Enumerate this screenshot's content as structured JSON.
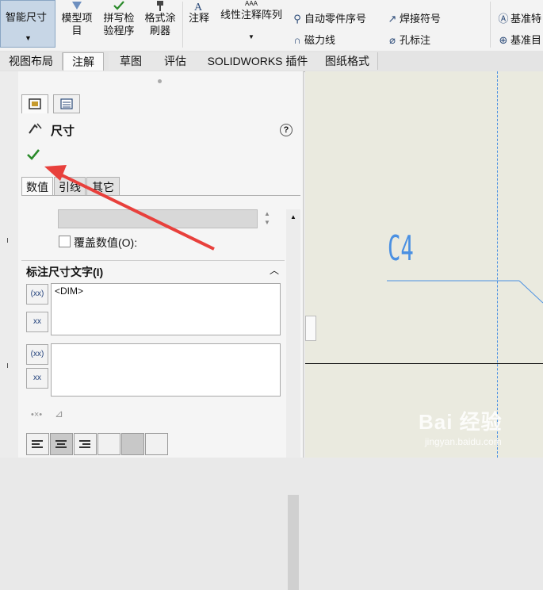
{
  "ribbon": {
    "smart_dimension": "智能尺寸",
    "model_items_l1": "模型项",
    "model_items_l2": "目",
    "spell_check_l1": "拼写检",
    "spell_check_l2": "验程序",
    "format_painter_l1": "格式涂",
    "format_painter_l2": "刷器",
    "note": "注释",
    "linear_note_pattern": "线性注释阵列",
    "auto_balloon": "自动零件序号",
    "magnetic_line": "磁力线",
    "weld_symbol": "焊接符号",
    "hole_callout": "孔标注",
    "datum_feature_1": "基准特",
    "datum_target_1": "基准目"
  },
  "tabs": [
    "视图布局",
    "注解",
    "草图",
    "评估",
    "SOLIDWORKS 插件",
    "图纸格式"
  ],
  "active_tab": "注解",
  "property_manager": {
    "title": "尺寸",
    "help": "?",
    "inner_tabs": [
      "数值",
      "引线",
      "其它"
    ],
    "override_value": "覆盖数值(O):",
    "dimension_text_header": "标注尺寸文字(I)",
    "dim_text": "<DIM>",
    "icon_paren": "(xx)",
    "icon_box": "xx"
  },
  "canvas": {
    "chamfer_label": "C4"
  },
  "watermark": {
    "brand": "Bai 经验",
    "url": "jingyan.baidu.com"
  },
  "colors": {
    "accent_blue": "#4a90e2",
    "arrow_red": "#e8403c",
    "check_green": "#2a8a2a"
  }
}
